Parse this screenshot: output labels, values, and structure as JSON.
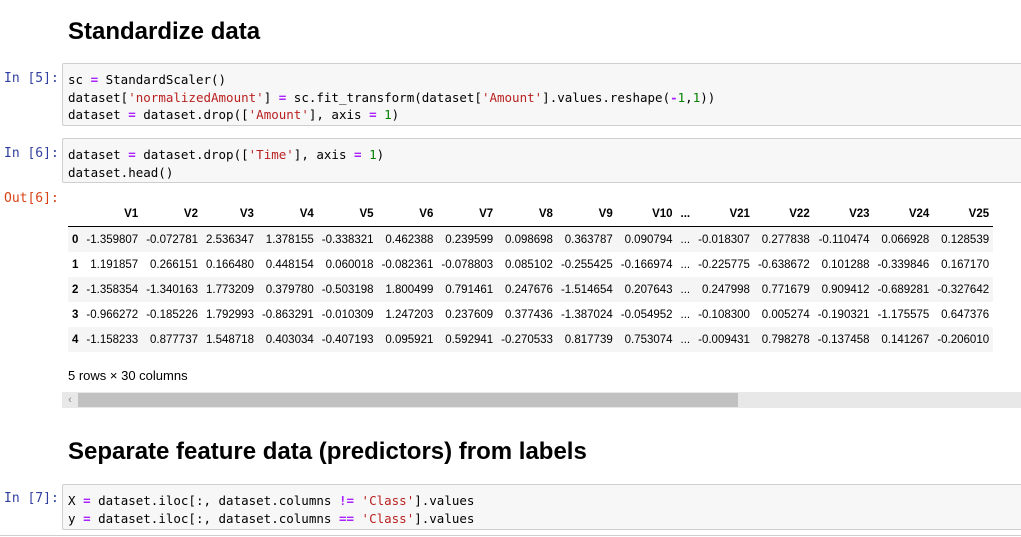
{
  "headings": {
    "standardize": "Standardize data",
    "separate": "Separate feature data (predictors) from labels"
  },
  "cells": {
    "in5": {
      "prompt": "In [5]:",
      "lines": [
        [
          [
            "sc ",
            ""
          ],
          [
            "=",
            "o"
          ],
          [
            " StandardScaler()",
            ""
          ]
        ],
        [
          [
            "dataset[",
            ""
          ],
          [
            "'normalizedAmount'",
            "s"
          ],
          [
            "] ",
            ""
          ],
          [
            "=",
            "o"
          ],
          [
            " sc.fit_transform(dataset[",
            ""
          ],
          [
            "'Amount'",
            "s"
          ],
          [
            "].values.reshape(",
            ""
          ],
          [
            "-",
            "o"
          ],
          [
            "1",
            "m"
          ],
          [
            ",",
            ""
          ],
          [
            "1",
            "m"
          ],
          [
            "))",
            ""
          ]
        ],
        [
          [
            "dataset ",
            ""
          ],
          [
            "=",
            "o"
          ],
          [
            " dataset.drop([",
            ""
          ],
          [
            "'Amount'",
            "s"
          ],
          [
            "], axis ",
            ""
          ],
          [
            "=",
            "o"
          ],
          [
            " ",
            ""
          ],
          [
            "1",
            "m"
          ],
          [
            ")",
            ""
          ]
        ]
      ]
    },
    "in6": {
      "prompt": "In [6]:",
      "lines": [
        [
          [
            "dataset ",
            ""
          ],
          [
            "=",
            "o"
          ],
          [
            " dataset.drop([",
            ""
          ],
          [
            "'Time'",
            "s"
          ],
          [
            "], axis ",
            ""
          ],
          [
            "=",
            "o"
          ],
          [
            " ",
            ""
          ],
          [
            "1",
            "m"
          ],
          [
            ")",
            ""
          ]
        ],
        [
          [
            "dataset.head()",
            ""
          ]
        ]
      ]
    },
    "out6": {
      "prompt": "Out[6]:"
    },
    "in7": {
      "prompt": "In [7]:",
      "lines": [
        [
          [
            "X ",
            ""
          ],
          [
            "=",
            "o"
          ],
          [
            " dataset.iloc[:, dataset.columns ",
            ""
          ],
          [
            "!=",
            "o"
          ],
          [
            " ",
            ""
          ],
          [
            "'Class'",
            "s"
          ],
          [
            "].values",
            ""
          ]
        ],
        [
          [
            "y ",
            ""
          ],
          [
            "=",
            "o"
          ],
          [
            " dataset.iloc[:, dataset.columns ",
            ""
          ],
          [
            "==",
            "o"
          ],
          [
            " ",
            ""
          ],
          [
            "'Class'",
            "s"
          ],
          [
            "].values",
            ""
          ]
        ]
      ]
    }
  },
  "dataframe": {
    "columns": [
      "",
      "V1",
      "V2",
      "V3",
      "V4",
      "V5",
      "V6",
      "V7",
      "V8",
      "V9",
      "V10",
      "...",
      "V21",
      "V22",
      "V23",
      "V24",
      "V25"
    ],
    "rows": [
      [
        "0",
        "-1.359807",
        "-0.072781",
        "2.536347",
        "1.378155",
        "-0.338321",
        "0.462388",
        "0.239599",
        "0.098698",
        "0.363787",
        "0.090794",
        "...",
        "-0.018307",
        "0.277838",
        "-0.110474",
        "0.066928",
        "0.128539"
      ],
      [
        "1",
        "1.191857",
        "0.266151",
        "0.166480",
        "0.448154",
        "0.060018",
        "-0.082361",
        "-0.078803",
        "0.085102",
        "-0.255425",
        "-0.166974",
        "...",
        "-0.225775",
        "-0.638672",
        "0.101288",
        "-0.339846",
        "0.167170"
      ],
      [
        "2",
        "-1.358354",
        "-1.340163",
        "1.773209",
        "0.379780",
        "-0.503198",
        "1.800499",
        "0.791461",
        "0.247676",
        "-1.514654",
        "0.207643",
        "...",
        "0.247998",
        "0.771679",
        "0.909412",
        "-0.689281",
        "-0.327642"
      ],
      [
        "3",
        "-0.966272",
        "-0.185226",
        "1.792993",
        "-0.863291",
        "-0.010309",
        "1.247203",
        "0.237609",
        "0.377436",
        "-1.387024",
        "-0.054952",
        "...",
        "-0.108300",
        "0.005274",
        "-0.190321",
        "-1.175575",
        "0.647376"
      ],
      [
        "4",
        "-1.158233",
        "0.877737",
        "1.548718",
        "0.403034",
        "-0.407193",
        "0.095921",
        "0.592941",
        "-0.270533",
        "0.817739",
        "0.753074",
        "...",
        "-0.009431",
        "0.798278",
        "-0.137458",
        "0.141267",
        "-0.206010"
      ]
    ],
    "shape_text": "5 rows × 30 columns"
  },
  "scrollbar": {
    "left_arrow": "‹",
    "thumb_fraction": 0.7
  },
  "colors": {
    "in_prompt": "#303f9f",
    "out_prompt": "#d84315",
    "string": "#ba2121",
    "operator": "#aa22ff",
    "number": "#008000"
  }
}
